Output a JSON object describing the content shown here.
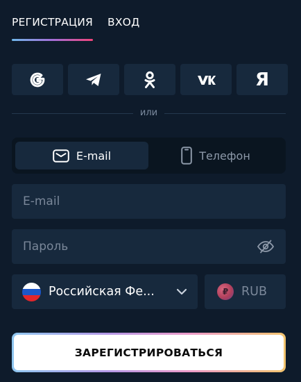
{
  "tabs": [
    {
      "label": "РЕГИСТРАЦИЯ",
      "active": true
    },
    {
      "label": "ВХОД",
      "active": false
    }
  ],
  "socials": [
    {
      "name": "google",
      "icon": "google-icon"
    },
    {
      "name": "telegram",
      "icon": "telegram-icon"
    },
    {
      "name": "odnoklassniki",
      "icon": "odnoklassniki-icon"
    },
    {
      "name": "vk",
      "icon": "vk-icon",
      "glyph": "ѵк"
    },
    {
      "name": "yandex",
      "icon": "yandex-icon",
      "glyph": "Я"
    }
  ],
  "divider": {
    "text": "или"
  },
  "switcher": {
    "email_label": "E-mail",
    "phone_label": "Телефон",
    "active": "email"
  },
  "email_field": {
    "placeholder": "E-mail",
    "value": ""
  },
  "password_field": {
    "placeholder": "Пароль",
    "value": ""
  },
  "country": {
    "name": "Российская Фе...",
    "flag_colors": [
      "#ffffff",
      "#1c57c9",
      "#e3262b"
    ]
  },
  "currency": {
    "code": "RUB",
    "symbol": "₽"
  },
  "submit": {
    "label": "ЗАРЕГИСТРИРОВАТЬСЯ"
  },
  "colors": {
    "background": "#0e1b2b",
    "field": "#17293d",
    "accent_gradient": [
      "#6fb7ea",
      "#a46fd9",
      "#f0447a"
    ]
  }
}
